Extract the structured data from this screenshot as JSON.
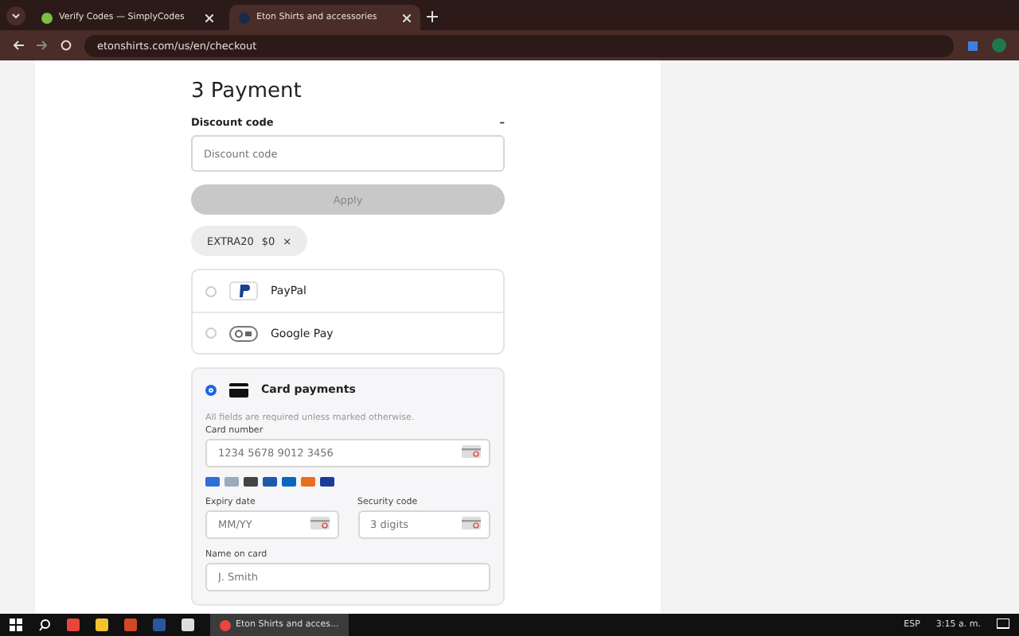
{
  "browser": {
    "tabs": [
      {
        "title": "Verify Codes — SimplyCodes",
        "selected": false
      },
      {
        "title": "Eton Shirts and accessories",
        "selected": true
      }
    ],
    "address": "etonshirts.com/us/en/checkout"
  },
  "payment": {
    "heading": "3 Payment",
    "discount": {
      "label": "Discount code",
      "toggle": "–",
      "placeholder": "Discount code",
      "apply": "Apply",
      "applied": {
        "code": "EXTRA20",
        "amount": "$0",
        "remove": "×"
      }
    },
    "methods": [
      {
        "kind": "paypal",
        "label": "PayPal",
        "selected": false
      },
      {
        "kind": "gpay",
        "label": "Google Pay",
        "selected": false
      },
      {
        "kind": "card",
        "label": "Card payments",
        "selected": true
      }
    ],
    "card_form": {
      "note": "All fields are required unless marked otherwise.",
      "card_number": {
        "label": "Card number",
        "placeholder": "1234 5678 9012 3456"
      },
      "expiry": {
        "label": "Expiry date",
        "placeholder": "MM/YY"
      },
      "security": {
        "label": "Security code",
        "placeholder": "3 digits"
      },
      "name": {
        "label": "Name on card",
        "placeholder": "J. Smith"
      }
    }
  },
  "taskbar": {
    "app": "Eton Shirts and acces...",
    "language": "ESP",
    "time": "3:15 a. m."
  }
}
